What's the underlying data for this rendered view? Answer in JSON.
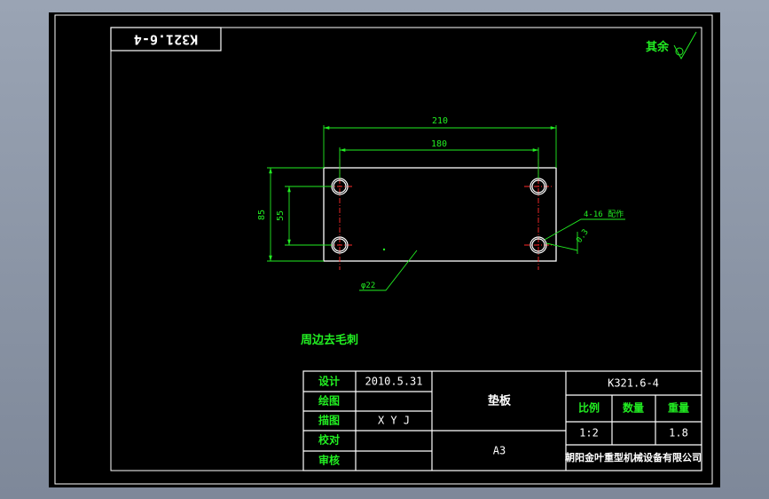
{
  "colors": {
    "background": "#000000",
    "frame": "#ffffff",
    "dimension": "#22ee22",
    "centerline": "#ff2a2a",
    "outside": "#8c97a8"
  },
  "drawing_number_rotated": "K321.6-4",
  "surface_note": {
    "text": "其余",
    "symbol_icon": "surface-roughness-icon"
  },
  "dimensions": {
    "overall_width": "210",
    "hole_spacing_x": "180",
    "overall_height": "85",
    "hole_spacing_y": "55",
    "hole_callout": "4-16 配作",
    "chamfer": "0.3",
    "center_diameter": "φ22"
  },
  "notes": {
    "deburr": "周边去毛刺"
  },
  "title_block": {
    "labels": {
      "design": "设计",
      "draw": "绘图",
      "trace": "描图",
      "check": "校对",
      "review": "审核"
    },
    "values": {
      "design": "2010.5.31",
      "draw": "",
      "trace": "X Y J",
      "check": "",
      "review": ""
    },
    "part_name": "垫板",
    "paper_size": "A3",
    "drawing_number": "K321.6-4",
    "scale_label": "比例",
    "quantity_label": "数量",
    "weight_label": "重量",
    "scale_value": "1:2",
    "quantity_value": "",
    "weight_value": "1.8",
    "company": "朝阳金叶重型机械设备有限公司"
  }
}
